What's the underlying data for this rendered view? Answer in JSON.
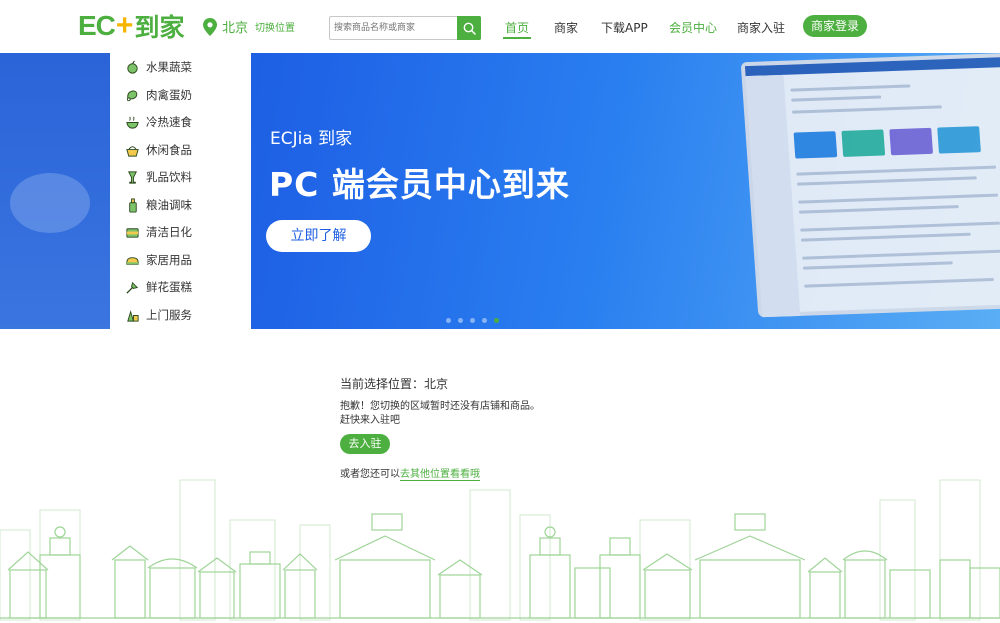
{
  "header": {
    "logo": {
      "ec": "EC",
      "plus": "+",
      "daojia": "到家"
    },
    "location": {
      "city": "北京",
      "switch_label": "切换位置"
    },
    "search": {
      "placeholder": "搜索商品名称或商家"
    },
    "nav": [
      {
        "label": "首页",
        "active": true
      },
      {
        "label": "商家"
      },
      {
        "label": "下载APP"
      },
      {
        "label": "会员中心"
      },
      {
        "label": "商家入驻"
      }
    ],
    "login_label": "商家登录"
  },
  "categories": [
    {
      "label": "水果蔬菜",
      "icon": "fruit-veg-icon"
    },
    {
      "label": "肉禽蛋奶",
      "icon": "meat-egg-icon"
    },
    {
      "label": "冷热速食",
      "icon": "fast-food-icon"
    },
    {
      "label": "休闲食品",
      "icon": "snack-basket-icon"
    },
    {
      "label": "乳品饮料",
      "icon": "drink-icon"
    },
    {
      "label": "粮油调味",
      "icon": "oil-bottle-icon"
    },
    {
      "label": "清洁日化",
      "icon": "cleaning-icon"
    },
    {
      "label": "家居用品",
      "icon": "home-goods-icon"
    },
    {
      "label": "鲜花蛋糕",
      "icon": "flower-icon"
    },
    {
      "label": "上门服务",
      "icon": "service-icon"
    }
  ],
  "banner": {
    "subtitle": "ECJia 到家",
    "title": "PC 端会员中心到来",
    "button_label": "立即了解",
    "slide_count": 5,
    "active_slide": 5
  },
  "content": {
    "current_location": "当前选择位置：北京",
    "sorry_line1": "抱歉！您切换的区域暂时还没有店铺和商品。",
    "sorry_line2": "赶快来入驻吧",
    "enter_button": "去入驻",
    "other_prefix": "或者您还可以",
    "other_link": "去其他位置看看哦"
  },
  "colors": {
    "brand_green": "#4caf3f",
    "logo_plus": "#f4b400",
    "banner_blue": "#1f63e6"
  }
}
